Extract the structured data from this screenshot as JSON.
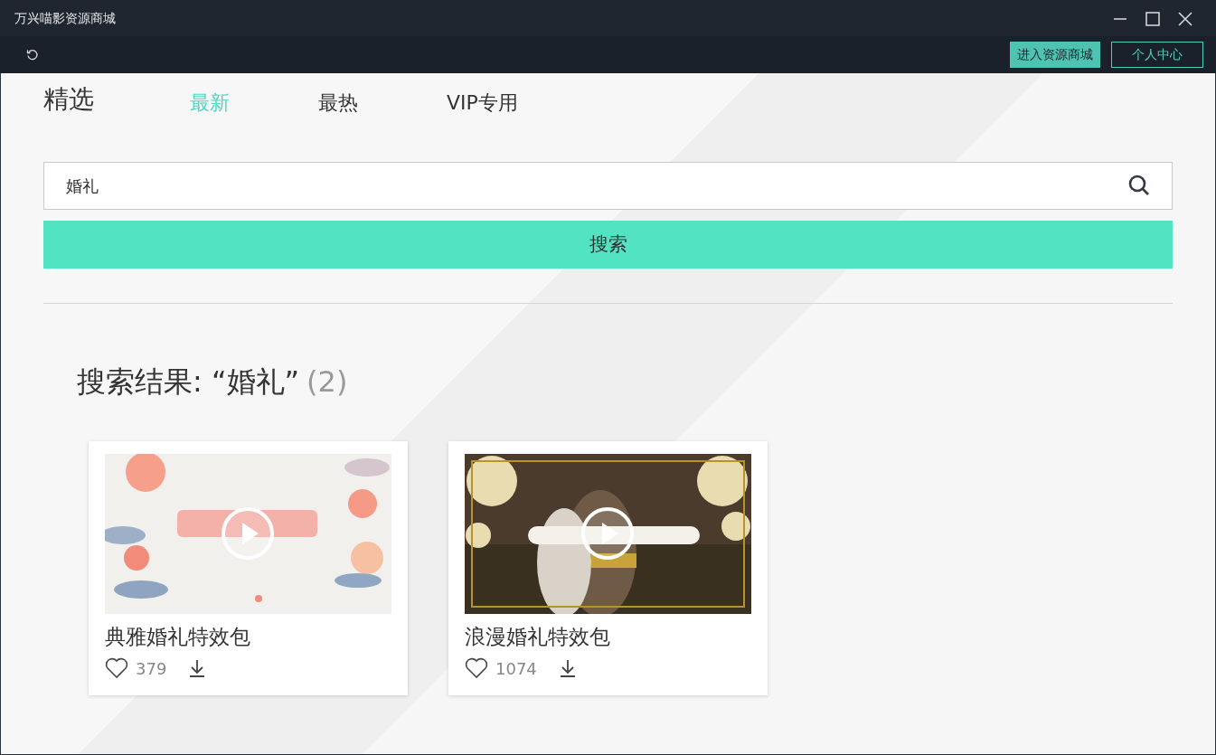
{
  "window": {
    "title": "万兴喵影资源商城"
  },
  "toolbar": {
    "buttons": [
      {
        "label": "进入资源商城",
        "kind": "filled"
      },
      {
        "label": "个人中心",
        "kind": "outline"
      }
    ]
  },
  "section_title": "精选",
  "tabs": [
    {
      "label": "最新",
      "selected": true
    },
    {
      "label": "最热",
      "selected": false
    },
    {
      "label": "VIP专用",
      "selected": false
    }
  ],
  "search": {
    "value": "婚礼",
    "button": "搜索"
  },
  "results": {
    "heading": "搜索结果: “婚礼”",
    "count": "(2)"
  },
  "items": [
    {
      "title": "典雅婚礼特效包",
      "likes": "379"
    },
    {
      "title": "浪漫婚礼特效包",
      "likes": "1074"
    }
  ]
}
